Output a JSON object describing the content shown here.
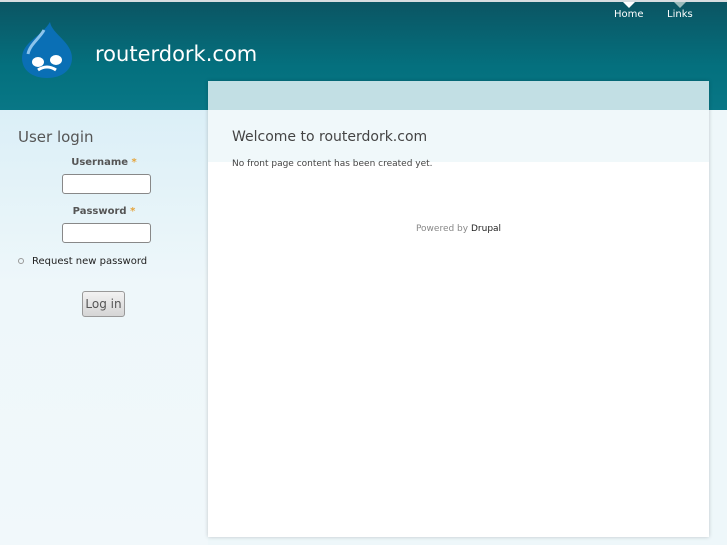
{
  "header": {
    "site_name": "routerdork.com",
    "nav": [
      {
        "label": "Home"
      },
      {
        "label": "Links"
      }
    ]
  },
  "sidebar": {
    "title": "User login",
    "username_label": "Username",
    "password_label": "Password",
    "required_mark": "*",
    "request_password": "Request new password",
    "login_button": "Log in"
  },
  "main": {
    "title": "Welcome to routerdork.com",
    "message": "No front page content has been created yet.",
    "powered_by": "Powered by",
    "drupal": "Drupal"
  }
}
